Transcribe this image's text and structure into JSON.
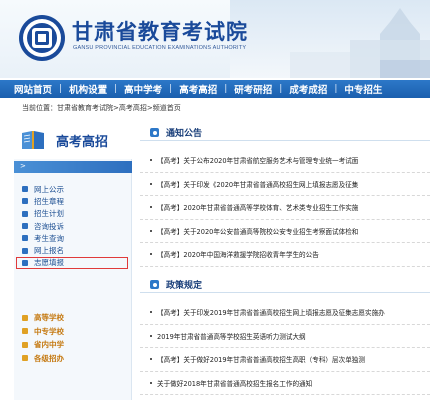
{
  "header": {
    "title_cn": "甘肃省教育考试院",
    "title_en": "GANSU PROVINCIAL EDUCATION EXAMINATIONS AUTHORITY"
  },
  "nav": {
    "items": [
      "网站首页",
      "机构设置",
      "高中学考",
      "高考高招",
      "研考研招",
      "成考成招",
      "中专招生"
    ]
  },
  "breadcrumb": {
    "text": "当前位置：甘肃省教育考试院>高考高招>频道首页"
  },
  "sidebar": {
    "title": "高考高招",
    "arrow": ">",
    "items": [
      {
        "label": "网上公示"
      },
      {
        "label": "招生章程"
      },
      {
        "label": "招生计划"
      },
      {
        "label": "咨询投诉"
      },
      {
        "label": "考生查询"
      },
      {
        "label": "网上报名"
      },
      {
        "label": "志愿填报"
      }
    ],
    "categories": [
      {
        "label": "高等学校"
      },
      {
        "label": "中专学校"
      },
      {
        "label": "省内中学"
      },
      {
        "label": "各级招办"
      }
    ]
  },
  "sections": [
    {
      "title": "通知公告",
      "rows": [
        "【高考】关于公布2020年甘肃省航空服务艺术与管理专业统一考试面",
        "【高考】关于印发《2020年甘肃省普通高校招生网上填报志愿及征集",
        "【高考】2020年甘肃省普通高等学校体育、艺术类专业招生工作实施",
        "【高考】关于2020年公安普通高等院校公安专业招生考察面试体检和",
        "【高考】2020年中国海洋救援学院招收青年学生的公告"
      ]
    },
    {
      "title": "政策规定",
      "rows": [
        "【高考】关于印发2019年甘肃省普通高校招生网上填报志愿及征集志愿实施办",
        "2019年甘肃省普通高等学校招生英语听力测试大纲",
        "【高考】关于做好2019年甘肃省普通高校招生高职（专科）层次单独测",
        "关于做好2018年甘肃省普通高校招生报名工作的通知"
      ]
    }
  ],
  "colors": {
    "nav_blue": "#1b5fae",
    "title_blue": "#1a4a9a",
    "highlight_red": "#e03a3a",
    "category_orange": "#c57a12"
  }
}
